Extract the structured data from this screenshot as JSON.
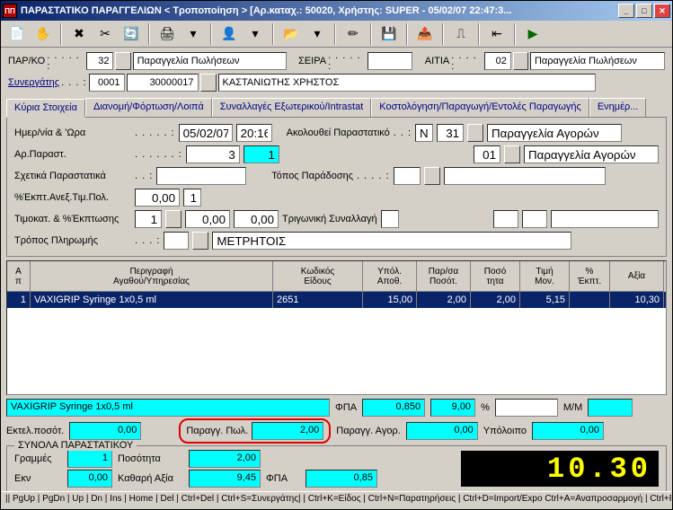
{
  "title": "ΠΑΡΑΣΤΑΤΙΚΟ ΠΑΡΑΓΓΕΛΙΩΝ < Τροποποίηση > [Αρ.καταχ.: 50020, Χρήστης: SUPER - 05/02/07 22:47:3...",
  "header": {
    "parko_label": "ΠΑΡ/ΚΟ",
    "parko_code": "32",
    "parko_desc": "Παραγγελία Πωλήσεων",
    "seira_label": "ΣΕΙΡΑ",
    "seira_val": "",
    "aitia_label": "ΑΙΤΙΑ",
    "aitia_code": "02",
    "aitia_desc": "Παραγγελία Πωλήσεων",
    "synergatis_label": "Συνεργάτης",
    "syn_code1": "0001",
    "syn_code2": "30000017",
    "syn_name": "ΚΑΣΤΑΝΙΩΤΗΣ ΧΡΗΣΤΟΣ"
  },
  "tabs": {
    "t1": "Κύρια Στοιχεία",
    "t2": "Διανομή/Φόρτωση/Λοιπά",
    "t3": "Συναλλαγές Εξωτερικού/Intrastat",
    "t4": "Κοστολόγηση/Παραγωγή/Εντολές Παραγωγής",
    "t5": "Ενημέρ..."
  },
  "details": {
    "date_label": "Ημερ/νία & 'Ωρα",
    "date": "05/02/07",
    "time": "20:16",
    "akol_label": "Ακολουθεί Παραστατικό",
    "akol_flag": "N",
    "akol_code": "31",
    "akol_desc": "Παραγγελία Αγορών",
    "arpar_label": "Αρ.Παραστ.",
    "arpar1": "3",
    "arpar2": "1",
    "assoc_code": "01",
    "assoc_desc": "Παραγγελία Αγορών",
    "sxetika_label": "Σχετικά Παραστατικά",
    "topos_label": "Τόπος Παράδοσης",
    "ekpt_label": "%Έκπτ.Ανεξ.Τιμ.Πολ.",
    "ekpt1": "0,00",
    "ekpt2": "1",
    "timokat_label": "Τιμοκατ. & %Έκπτωσης",
    "timokat1": "1",
    "timokat2": "0,00",
    "timokat3": "0,00",
    "trig_label": "Τριγωνική Συναλλαγή",
    "tropos_label": "Τρόπος Πληρωμής",
    "tropos_desc": "ΜΕΤΡΗΤΟΙΣ"
  },
  "grid": {
    "col0": "Α\nπ",
    "col1": "Περιγραφή\nΑγαθού/Υπηρεσίας",
    "col2": "Κωδικός\nΕίδους",
    "col3": "Υπόλ.\nΑποθ.",
    "col4": "Παρ/σα\nΠοσότ.",
    "col5": "Ποσό\nτητα",
    "col6": "Τιμή\nΜον.",
    "col7": "%\nΈκπτ.",
    "col8": "Αξία",
    "r": {
      "num": "1",
      "desc": "VAXIGRIP Syringe 1x0,5 ml",
      "code": "2651",
      "stock": "15,00",
      "ordqty": "2,00",
      "qty": "2,00",
      "price": "5,15",
      "disc": "",
      "value": "10,30"
    }
  },
  "summary1": {
    "item": "VAXIGRIP Syringe 1x0,5 ml",
    "fpa_label": "ΦΠΑ",
    "fpa_val": "0,850",
    "pct": "9,00",
    "pct_sym": "%",
    "mm_label": "M/M",
    "mm_val": ""
  },
  "summary2": {
    "ektel_label": "Εκτελ.ποσότ.",
    "ektel": "0,00",
    "parpol_label": "Παραγγ. Πωλ.",
    "parpol": "2,00",
    "paragor_label": "Παραγγ. Αγορ.",
    "paragor": "0,00",
    "ypol_label": "Υπόλοιπο",
    "ypol": "0,00"
  },
  "totals": {
    "legend": "ΣΥΝΟΛΑ ΠΑΡΑΣΤΑΤΙΚΟΥ",
    "grammes_label": "Γραμμές",
    "grammes": "1",
    "posot_label": "Ποσότητα",
    "posot": "2,00",
    "ekn_label": "Εκν",
    "ekn": "0,00",
    "kath_label": "Καθαρή Αξία",
    "kath": "9,45",
    "fpa_label": "ΦΠΑ",
    "fpa": "0,85",
    "led": "10.30"
  },
  "status": "|| PgUp | PgDn | Up | Dn | Ins | Home | Del | Ctrl+Del | Ctrl+S=Συνεργάτης| | Ctrl+K=Είδος | Ctrl+N=Παρατηρήσεις | Ctrl+D=Import/Expo  Ctrl+A=Αναπροσαρμογή | Ctrl+P=Εκτύπωση || ESC='Εξοδος ||"
}
